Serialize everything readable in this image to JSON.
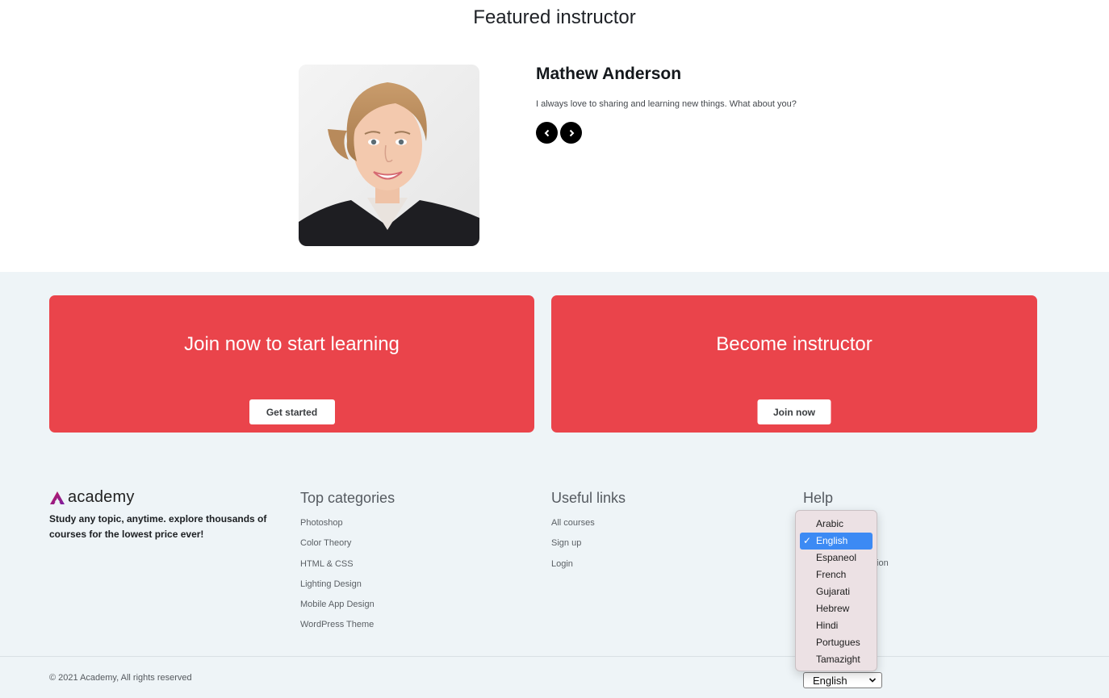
{
  "featured": {
    "title": "Featured instructor",
    "name": "Mathew Anderson",
    "bio": "I always love to sharing and learning new things. What about you?",
    "prev_icon": "chevron-left-icon",
    "next_icon": "chevron-right-icon"
  },
  "cta": [
    {
      "heading": "Join now to start learning",
      "button": "Get started"
    },
    {
      "heading": "Become instructor",
      "button": "Join now"
    }
  ],
  "colors": {
    "accent": "#ea444b",
    "footer_bg": "#eef4f7",
    "select_highlight": "#3c8af4"
  },
  "footer": {
    "brand": "academy",
    "tagline": "Study any topic, anytime. explore thousands of courses for the lowest price ever!",
    "top_categories": {
      "title": "Top categories",
      "items": [
        "Photoshop",
        "Color Theory",
        "HTML & CSS",
        "Lighting Design",
        "Mobile App Design",
        "WordPress Theme"
      ]
    },
    "useful_links": {
      "title": "Useful links",
      "items": [
        "All courses",
        "Sign up",
        "Login"
      ]
    },
    "help": {
      "title": "Help",
      "obscured_fragment": "tion"
    },
    "copyright": "© 2021 Academy, All rights reserved",
    "language": {
      "selected": "English",
      "options": [
        "Arabic",
        "English",
        "Espaneol",
        "French",
        "Gujarati",
        "Hebrew",
        "Hindi",
        "Portugues",
        "Tamazight"
      ]
    }
  }
}
